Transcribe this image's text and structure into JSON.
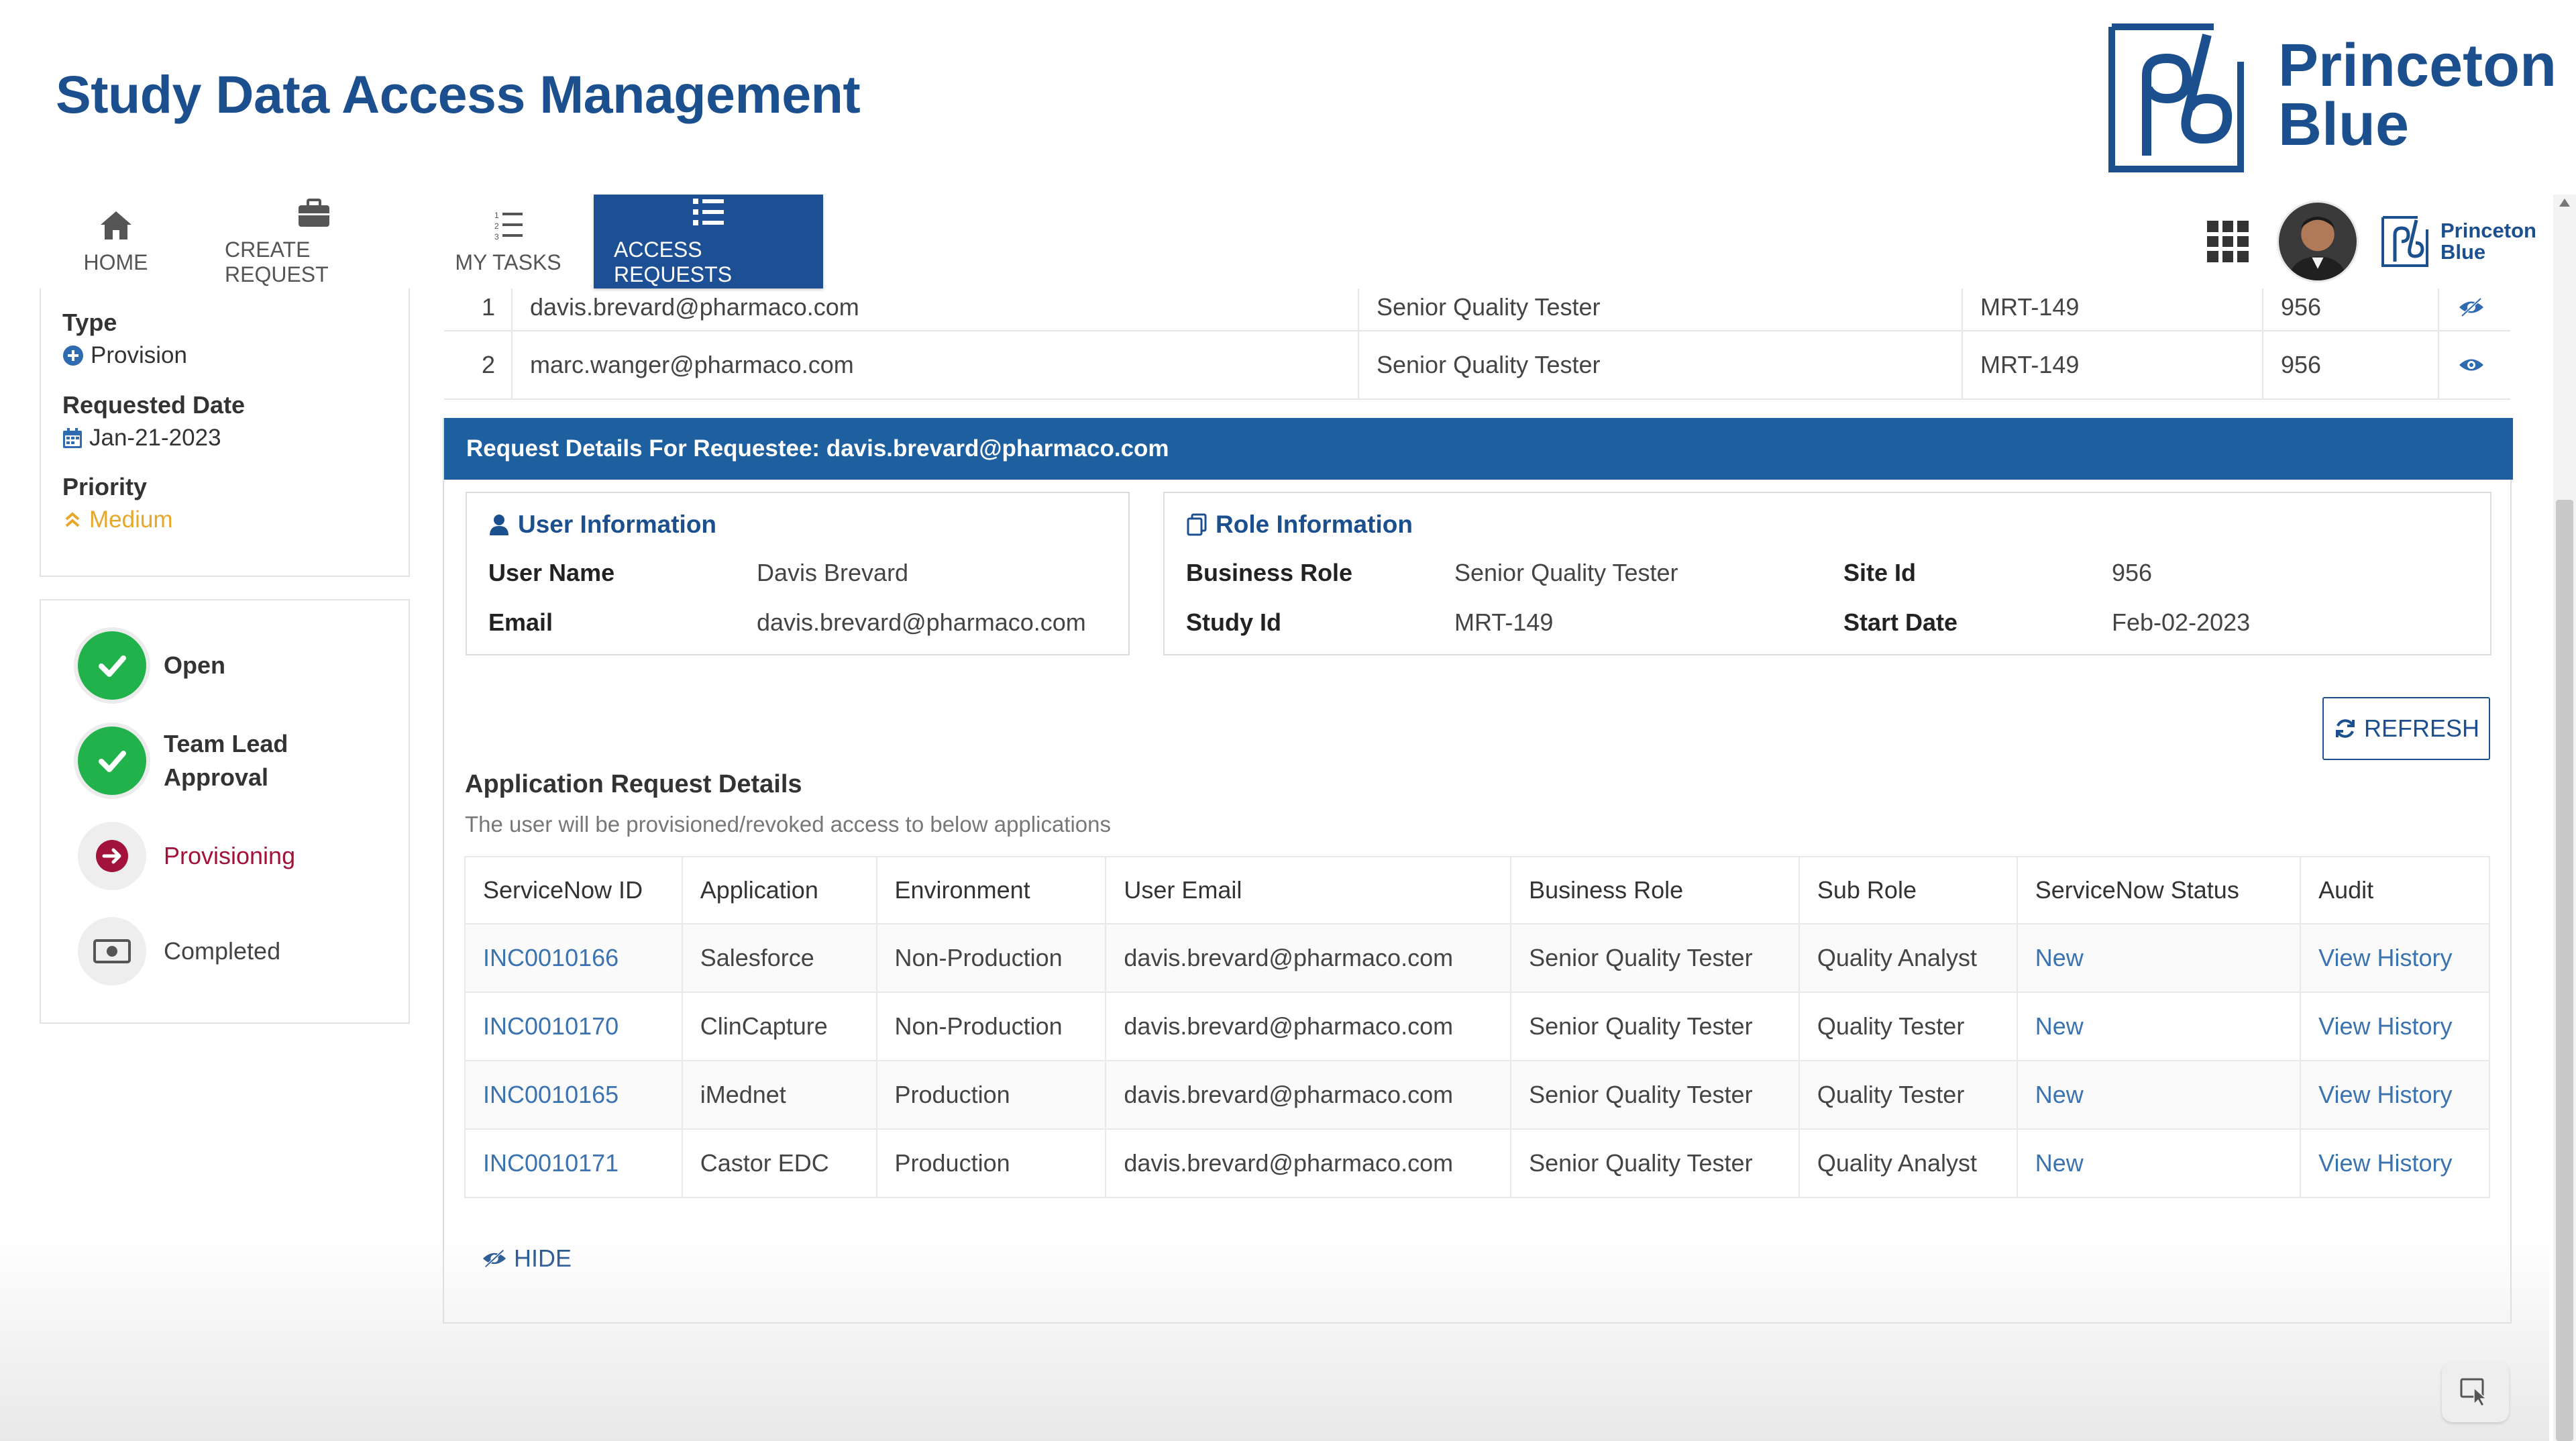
{
  "app": {
    "title": "Study Data Access Management"
  },
  "brand": {
    "line1": "Princeton",
    "line2": "Blue"
  },
  "nav": {
    "home": "HOME",
    "create_request": "CREATE REQUEST",
    "my_tasks": "MY TASKS",
    "access_requests": "ACCESS REQUESTS",
    "active": "access_requests"
  },
  "request_info": {
    "type_label": "Type",
    "type_value": "Provision",
    "requested_date_label": "Requested Date",
    "requested_date_value": "Jan-21-2023",
    "priority_label": "Priority",
    "priority_value": "Medium"
  },
  "workflow": {
    "steps": [
      {
        "label_line1": "Open",
        "label_line2": "",
        "status": "done"
      },
      {
        "label_line1": "Team Lead",
        "label_line2": "Approval",
        "status": "done"
      },
      {
        "label_line1": "Provisioning",
        "label_line2": "",
        "status": "active"
      },
      {
        "label_line1": "Completed",
        "label_line2": "",
        "status": "pending"
      }
    ]
  },
  "requestees": [
    {
      "num": "1",
      "email": "davis.brevard@pharmaco.com",
      "role": "Senior Quality Tester",
      "study": "MRT-149",
      "site": "956",
      "icon": "eye-slash-icon"
    },
    {
      "num": "2",
      "email": "marc.wanger@pharmaco.com",
      "role": "Senior Quality Tester",
      "study": "MRT-149",
      "site": "956",
      "icon": "eye-icon"
    }
  ],
  "details": {
    "header": "Request Details For Requestee: davis.brevard@pharmaco.com",
    "user_info": {
      "title": "User Information",
      "user_name_label": "User Name",
      "user_name": "Davis Brevard",
      "email_label": "Email",
      "email": "davis.brevard@pharmaco.com"
    },
    "role_info": {
      "title": "Role Information",
      "business_role_label": "Business Role",
      "business_role": "Senior Quality Tester",
      "study_id_label": "Study Id",
      "study_id": "MRT-149",
      "site_id_label": "Site Id",
      "site_id": "956",
      "start_date_label": "Start Date",
      "start_date": "Feb-02-2023"
    },
    "refresh_label": "REFRESH",
    "apps_title": "Application Request Details",
    "apps_subtitle": "The user will be provisioned/revoked access to below applications",
    "hide_label": "HIDE"
  },
  "apps_table": {
    "columns": [
      "ServiceNow ID",
      "Application",
      "Environment",
      "User Email",
      "Business Role",
      "Sub Role",
      "ServiceNow Status",
      "Audit"
    ],
    "rows": [
      [
        "INC0010166",
        "Salesforce",
        "Non-Production",
        "davis.brevard@pharmaco.com",
        "Senior Quality Tester",
        "Quality Analyst",
        "New",
        "View History"
      ],
      [
        "INC0010170",
        "ClinCapture",
        "Non-Production",
        "davis.brevard@pharmaco.com",
        "Senior Quality Tester",
        "Quality Tester",
        "New",
        "View History"
      ],
      [
        "INC0010165",
        "iMednet",
        "Production",
        "davis.brevard@pharmaco.com",
        "Senior Quality Tester",
        "Quality Tester",
        "New",
        "View History"
      ],
      [
        "INC0010171",
        "Castor EDC",
        "Production",
        "davis.brevard@pharmaco.com",
        "Senior Quality Tester",
        "Quality Analyst",
        "New",
        "View History"
      ]
    ]
  },
  "colors": {
    "brand_blue": "#1b4f8e",
    "nav_active": "#1c4f94",
    "details_bar": "#1d5f9f",
    "success_green": "#22b24c",
    "provisioning_red": "#a3123a",
    "priority_medium": "#e6a72a",
    "link_blue": "#3a73b0"
  }
}
